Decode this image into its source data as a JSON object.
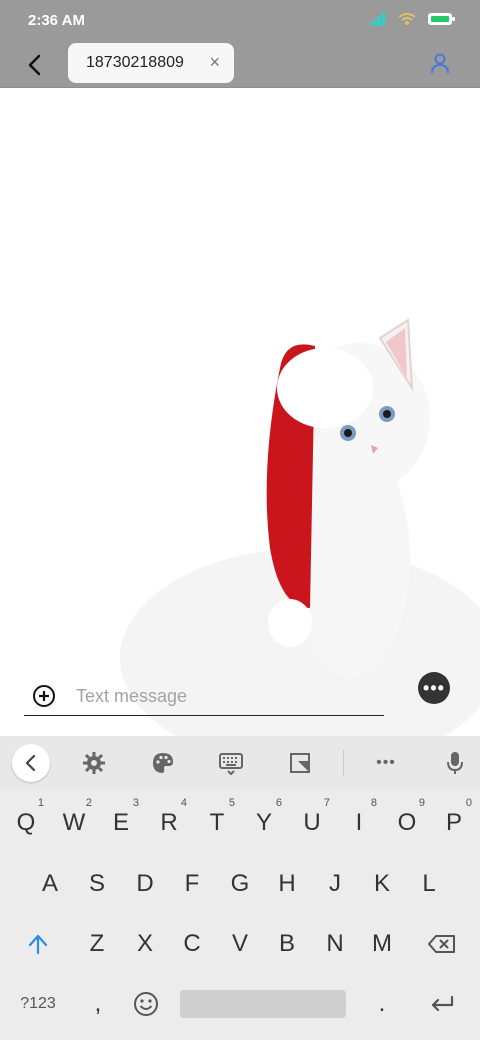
{
  "status_bar": {
    "time": "2:36 AM",
    "icons": [
      "signal-icon",
      "wifi-icon",
      "battery-icon"
    ],
    "colors": {
      "signal": "#2bd3c8",
      "battery": "#25c86b"
    }
  },
  "header": {
    "back_icon": "arrow-left-icon",
    "recipient_chip": "18730218809",
    "chip_close": "×",
    "contact_icon": "person-icon"
  },
  "attachment": {
    "description_icon": "image-kitten-santa-hat"
  },
  "compose": {
    "placeholder": "Text message",
    "add_icon": "plus-circle-icon",
    "more_icon": "more-dots-icon",
    "more_glyph": "•••"
  },
  "keyboard": {
    "toolbar": [
      "chevron-left-icon",
      "gear-icon",
      "palette-icon",
      "keyboard-icon",
      "sticky-note-icon",
      "more-icon",
      "mic-icon"
    ],
    "more_glyph": "•••",
    "row1": [
      {
        "key": "Q",
        "hint": "1"
      },
      {
        "key": "W",
        "hint": "2"
      },
      {
        "key": "E",
        "hint": "3"
      },
      {
        "key": "R",
        "hint": "4"
      },
      {
        "key": "T",
        "hint": "5"
      },
      {
        "key": "Y",
        "hint": "6"
      },
      {
        "key": "U",
        "hint": "7"
      },
      {
        "key": "I",
        "hint": "8"
      },
      {
        "key": "O",
        "hint": "9"
      },
      {
        "key": "P",
        "hint": "0"
      }
    ],
    "row2": [
      "A",
      "S",
      "D",
      "F",
      "G",
      "H",
      "J",
      "K",
      "L"
    ],
    "row3": [
      "Z",
      "X",
      "C",
      "V",
      "B",
      "N",
      "M"
    ],
    "row4": {
      "symbols": "?123",
      "comma": ",",
      "period": "."
    }
  }
}
